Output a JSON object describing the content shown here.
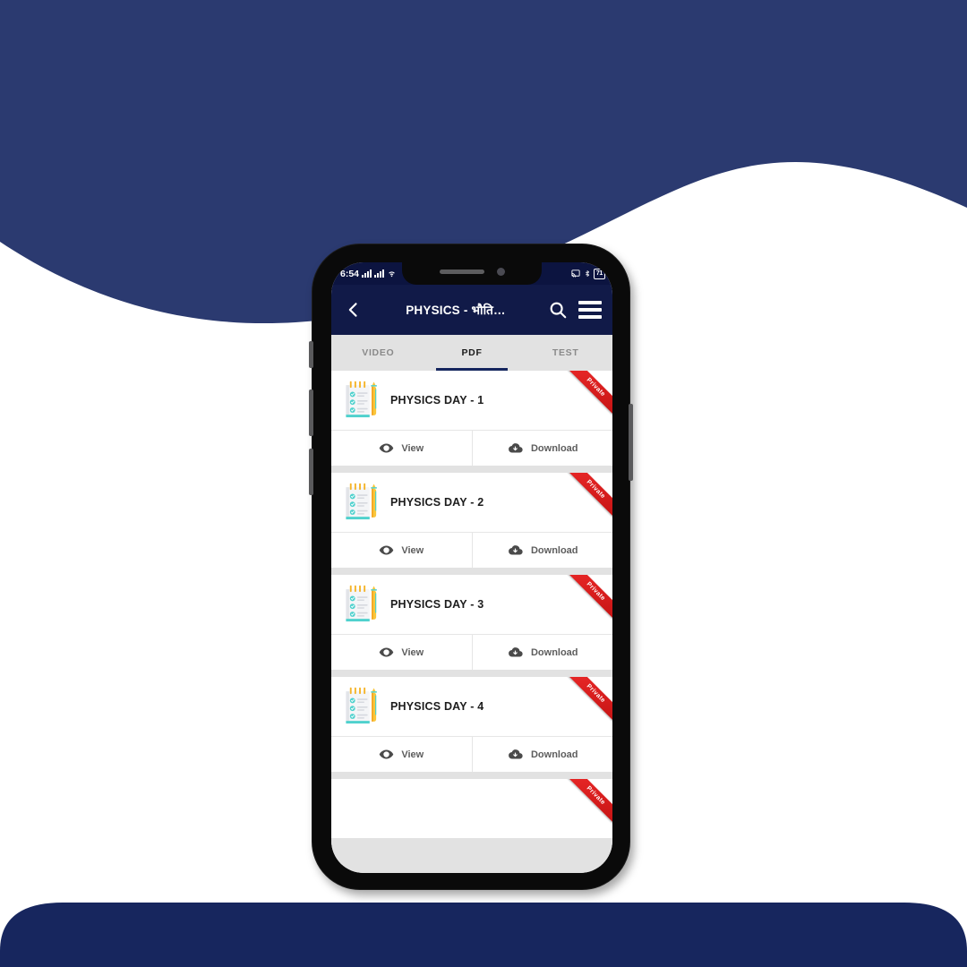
{
  "background": {
    "navy": "#2b3a70",
    "white": "#ffffff"
  },
  "phone": {
    "status_bar": {
      "time": "6:54",
      "signal_icon": "signal-bars-icon",
      "signal_icon_2": "signal-bars-icon",
      "wifi_icon": "wifi-icon",
      "cast_icon": "cast-icon",
      "bluetooth_icon": "bluetooth-icon",
      "battery_level": "71"
    },
    "app_bar": {
      "back_icon": "back-chevron-icon",
      "title": "PHYSICS - भौति…",
      "search_icon": "search-icon",
      "menu_icon": "hamburger-menu-icon"
    },
    "tabs": [
      {
        "label": "VIDEO",
        "active": false
      },
      {
        "label": "PDF",
        "active": true
      },
      {
        "label": "TEST",
        "active": false
      }
    ],
    "accent_active_tab": "#15265e",
    "ribbon_label": "Private",
    "actions": {
      "view_label": "View",
      "view_icon": "eye-icon",
      "download_label": "Download",
      "download_icon": "cloud-download-icon"
    },
    "pdf_items": [
      {
        "title": "PHYSICS DAY - 1",
        "icon": "notepad-pencil-icon",
        "badge": "Private"
      },
      {
        "title": "PHYSICS DAY - 2",
        "icon": "notepad-pencil-icon",
        "badge": "Private"
      },
      {
        "title": "PHYSICS DAY - 3",
        "icon": "notepad-pencil-icon",
        "badge": "Private"
      },
      {
        "title": "PHYSICS DAY - 4",
        "icon": "notepad-pencil-icon",
        "badge": "Private"
      },
      {
        "title": "",
        "icon": "notepad-pencil-icon",
        "badge": "Private"
      }
    ]
  }
}
